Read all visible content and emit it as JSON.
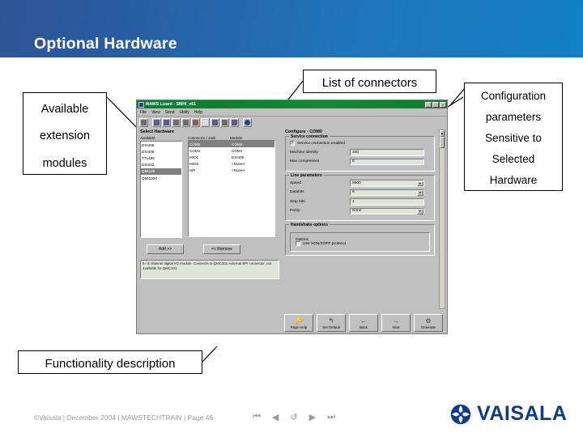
{
  "header": {
    "title": "Optional Hardware"
  },
  "callouts": {
    "connectors": "List of connectors",
    "modules": [
      "Available",
      "extension",
      "modules"
    ],
    "configuration": [
      "Configuration",
      "parameters",
      "Sensitive to",
      "Selected",
      "Hardware"
    ],
    "functionality": "Functionality description"
  },
  "app": {
    "titlebar": {
      "title": "MAWS Lizard - SMHI_v61",
      "minimize": "_",
      "maximize": "□",
      "close": "×",
      "icon": "app-icon"
    },
    "menu": [
      "File",
      "View",
      "Send",
      "Utility",
      "Help"
    ],
    "toolbar_icons": [
      "open-icon",
      "connect-icon",
      "refresh-icon",
      "ruler-icon",
      "list-icon",
      "network-icon",
      "blank-icon",
      "edit-icon",
      "warning-icon",
      "grid-icon",
      "info-icon"
    ],
    "left_pane": {
      "title": "Select Hardware",
      "available_header": "Available",
      "available_items": [
        "DSI486",
        "DSI485",
        "TTL485",
        "DSI232",
        "QMI108",
        "QMI1000"
      ],
      "available_selected_index": 4,
      "connector_headers": [
        "Connector / Jack",
        "Module"
      ],
      "connector_rows": [
        {
          "jack": "COM0",
          "module": "COM0"
        },
        {
          "jack": "COM1",
          "module": "COM1"
        },
        {
          "jack": "MIO1",
          "module": "DSI486"
        },
        {
          "jack": "MIO2",
          "module": "<None>"
        },
        {
          "jack": "SPI",
          "module": "<None>"
        }
      ],
      "connector_selected_index": 0,
      "add_button": "Add >>",
      "remove_button": "<< Remove",
      "note": "8 / 8 channel digital I/O module. Connects to QMC201 external SPI connector, not available for QMC101."
    },
    "right_pane": {
      "title": "Configure - COM0",
      "service_connection": {
        "group_label": "Service connection",
        "enabled_label": "Service connection enabled",
        "enabled_checked": true,
        "fields": [
          {
            "label": "Machine identity",
            "value": "330"
          },
          {
            "label": "Max compresses",
            "value": "8"
          }
        ]
      },
      "line_parameters": {
        "group_label": "Line parameters",
        "fields": [
          {
            "label": "Speed",
            "value": "9600",
            "type": "combo"
          },
          {
            "label": "Databits",
            "value": "8",
            "type": "combo"
          },
          {
            "label": "Stop bits",
            "value": "1",
            "type": "text"
          },
          {
            "label": "Parity",
            "value": "None",
            "type": "combo"
          }
        ]
      },
      "handshake_options": {
        "group_label": "Handshake options",
        "sub_label": "Options",
        "xonxoff_label": "Use XON/XOFF protocol",
        "xonxoff_checked": false
      },
      "scrollbar": {
        "up": "▲",
        "down": "▼"
      }
    },
    "bottom_buttons": [
      {
        "label": "Page Help",
        "icon": "key-icon"
      },
      {
        "label": "Set Default",
        "icon": "undo-arrow-icon"
      },
      {
        "label": "Back",
        "icon": "left-arrow-icon"
      },
      {
        "label": "Next",
        "icon": "right-arrow-icon"
      },
      {
        "label": "Generate",
        "icon": "gears-icon"
      }
    ]
  },
  "footer": {
    "text": "©Vaisala | December 2004 | MAWSTECHTRAIN | Page 46",
    "nav": [
      "⏮",
      "◀",
      "↺",
      "▶",
      "⏭"
    ],
    "logo_text": "VAISALA"
  }
}
